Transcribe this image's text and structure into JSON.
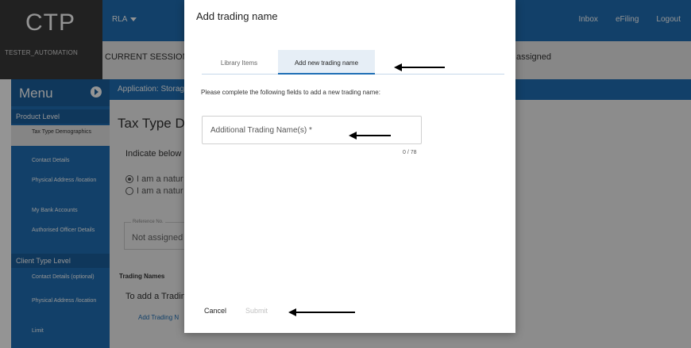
{
  "header": {
    "logo": "CTP",
    "user": "TESTER_AUTOMATION",
    "org": "RLA",
    "nav": [
      "Inbox",
      "eFiling",
      "Logout"
    ]
  },
  "session": {
    "current": "CURRENT SESSION",
    "assigned": "assigned"
  },
  "sidebar": {
    "title": "Menu",
    "product_section": "Product Level",
    "product_items": [
      {
        "label": "Tax Type Demographics"
      },
      {
        "label": "Contact Details"
      },
      {
        "label": "Physical Address /location"
      },
      {
        "label": "My Bank Accounts"
      },
      {
        "label": "Authorised Officer Details"
      }
    ],
    "client_section": "Client Type Level",
    "client_items": [
      {
        "label": "Contact Details (optional)"
      },
      {
        "label": "Physical Address /location"
      },
      {
        "label": "Limit"
      }
    ]
  },
  "appbar": {
    "text": "Application: Storag"
  },
  "background": {
    "title": "Tax Type De",
    "indicate": "Indicate below if",
    "radio1": "I am a natur",
    "radio2": "I am a natur",
    "ref_label": "Reference No.",
    "ref_value": "Not assigned",
    "trading_title": "Trading Names",
    "trading_add": "To add a Tradin",
    "trading_link": "Add Trading N"
  },
  "modal": {
    "title": "Add trading name",
    "tabs": [
      "Library Items",
      "Add new trading name"
    ],
    "instruction": "Please complete the following fields to add a new trading name:",
    "field_placeholder": "Additional Trading Name(s) *",
    "counter": "0 / 78",
    "cancel": "Cancel",
    "submit": "Submit"
  },
  "colors": {
    "primary": "#1f6fb5",
    "brand_bg": "#3a3a3a"
  }
}
